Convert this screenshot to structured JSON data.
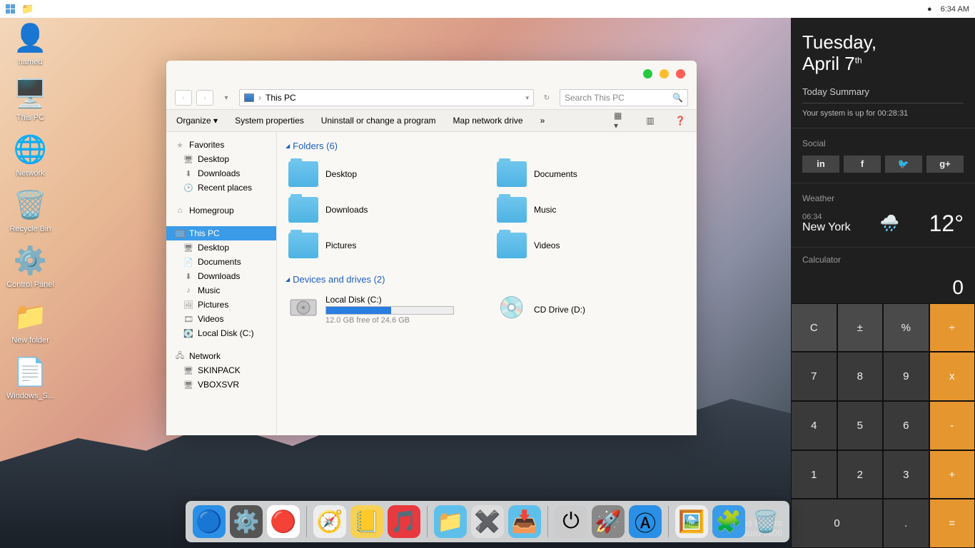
{
  "topbar": {
    "clock": "6:34 AM"
  },
  "desktop_icons": [
    {
      "name": "user-icon",
      "label": "hamed",
      "glyph": "👤"
    },
    {
      "name": "this-pc-icon",
      "label": "This PC",
      "glyph": "🖥️"
    },
    {
      "name": "network-icon",
      "label": "Network",
      "glyph": "🌐"
    },
    {
      "name": "recycle-bin-icon",
      "label": "Recycle Bin",
      "glyph": "🗑️"
    },
    {
      "name": "control-panel-icon",
      "label": "Control Panel",
      "glyph": "⚙️"
    },
    {
      "name": "new-folder-icon",
      "label": "New folder",
      "glyph": "📁"
    },
    {
      "name": "windows-shortcut-icon",
      "label": "Windows_S...",
      "glyph": "📄"
    }
  ],
  "explorer": {
    "location": "This PC",
    "search_placeholder": "Search This PC",
    "toolbar": {
      "organize": "Organize",
      "sysprops": "System properties",
      "uninstall": "Uninstall or change a program",
      "mapdrive": "Map network drive"
    },
    "sidebar": {
      "favorites": {
        "label": "Favorites",
        "items": [
          "Desktop",
          "Downloads",
          "Recent places"
        ]
      },
      "homegroup": {
        "label": "Homegroup"
      },
      "thispc": {
        "label": "This PC",
        "items": [
          "Desktop",
          "Documents",
          "Downloads",
          "Music",
          "Pictures",
          "Videos",
          "Local Disk (C:)"
        ]
      },
      "network": {
        "label": "Network",
        "items": [
          "SKINPACK",
          "VBOXSVR"
        ]
      }
    },
    "sections": {
      "folders": {
        "header": "Folders (6)",
        "items": [
          "Desktop",
          "Documents",
          "Downloads",
          "Music",
          "Pictures",
          "Videos"
        ]
      },
      "drives": {
        "header": "Devices and drives (2)",
        "local": {
          "name": "Local Disk (C:)",
          "free": "12.0 GB free of 24.6 GB",
          "fill_pct": 51
        },
        "cd": {
          "name": "CD Drive (D:)"
        }
      }
    }
  },
  "rpanel": {
    "day": "Tuesday,",
    "date_month": "April 7",
    "date_suffix": "th",
    "summary_label": "Today Summary",
    "uptime": "Your system is up for 00:28:31",
    "social_label": "Social",
    "weather": {
      "label": "Weather",
      "time": "06:34",
      "city": "New York",
      "temp": "12°"
    },
    "calc": {
      "label": "Calculator",
      "display": "0",
      "buttons": [
        {
          "t": "C",
          "c": "lt"
        },
        {
          "t": "±",
          "c": "lt"
        },
        {
          "t": "%",
          "c": "lt"
        },
        {
          "t": "÷",
          "c": "op"
        },
        {
          "t": "7",
          "c": ""
        },
        {
          "t": "8",
          "c": ""
        },
        {
          "t": "9",
          "c": ""
        },
        {
          "t": "x",
          "c": "op"
        },
        {
          "t": "4",
          "c": ""
        },
        {
          "t": "5",
          "c": ""
        },
        {
          "t": "6",
          "c": ""
        },
        {
          "t": "-",
          "c": "op"
        },
        {
          "t": "1",
          "c": ""
        },
        {
          "t": "2",
          "c": ""
        },
        {
          "t": "3",
          "c": ""
        },
        {
          "t": "+",
          "c": "op"
        },
        {
          "t": "0",
          "c": "wide"
        },
        {
          "t": ".",
          "c": ""
        },
        {
          "t": "=",
          "c": "op"
        }
      ]
    }
  },
  "dock": [
    {
      "name": "finder",
      "glyph": "🔵",
      "bg": "#2a8fe6"
    },
    {
      "name": "system-preferences",
      "glyph": "⚙️",
      "bg": "#555"
    },
    {
      "name": "game-center",
      "glyph": "🔴",
      "bg": "#fff"
    },
    {
      "name": "sep"
    },
    {
      "name": "safari",
      "glyph": "🧭",
      "bg": "#eee"
    },
    {
      "name": "notes",
      "glyph": "📒",
      "bg": "#f7d154"
    },
    {
      "name": "music",
      "glyph": "🎵",
      "bg": "#e8393e"
    },
    {
      "name": "sep"
    },
    {
      "name": "files",
      "glyph": "📁",
      "bg": "#5ec0ea"
    },
    {
      "name": "yosemite",
      "glyph": "✖️",
      "bg": "#ddd"
    },
    {
      "name": "downloads",
      "glyph": "📥",
      "bg": "#5ec0ea"
    },
    {
      "name": "sep"
    },
    {
      "name": "power",
      "glyph": "⏻",
      "bg": "#ccc"
    },
    {
      "name": "launchpad",
      "glyph": "🚀",
      "bg": "#888"
    },
    {
      "name": "app-store",
      "glyph": "Ⓐ",
      "bg": "#2a8fe6"
    },
    {
      "name": "sep"
    },
    {
      "name": "photos",
      "glyph": "🖼️",
      "bg": "#eee"
    },
    {
      "name": "widgets",
      "glyph": "🧩",
      "bg": "#3a9be8"
    },
    {
      "name": "trash",
      "glyph": "🗑️",
      "bg": "transparent"
    }
  ],
  "watermark": {
    "line1": "Windows 8.1 Pro",
    "line2": "Build 9600"
  }
}
